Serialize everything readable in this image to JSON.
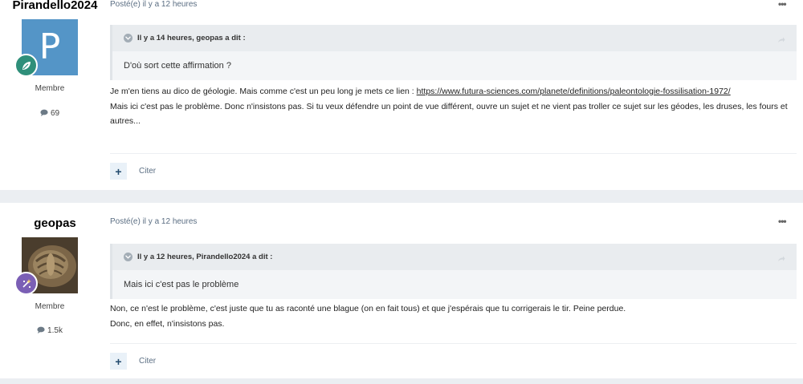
{
  "posts": [
    {
      "author": "Pirandello2024",
      "avatar_letter": "P",
      "avatar_color": "#5495c7",
      "badge_icon": "leaf-icon",
      "badge_color": "#2f8f7a",
      "role": "Membre",
      "post_count": "69",
      "posted": "Posté(e) il y a 12 heures",
      "quote": {
        "header": "Il y a 14 heures, geopas a dit :",
        "text": "D'où sort cette affirmation ?"
      },
      "content": {
        "line1_prefix": "Je m'en tiens au dico de géologie. Mais comme c'est un peu long je mets ce lien : ",
        "link": "https://www.futura-sciences.com/planete/definitions/paleontologie-fossilisation-1972/",
        "line2": "Mais ici c'est pas le problème. Donc n'insistons pas. Si tu veux défendre un point de vue différent, ouvre un sujet et ne vient pas troller ce sujet sur les géodes, les druses, les fours et autres..."
      },
      "action_plus": "+",
      "action_cite": "Citer"
    },
    {
      "author": "geopas",
      "badge_icon": "sparkle-icon",
      "badge_color": "#7b5fb5",
      "role": "Membre",
      "post_count": "1.5k",
      "posted": "Posté(e) il y a 12 heures",
      "quote": {
        "header": "Il y a 12 heures, Pirandello2024 a dit :",
        "text": "Mais ici c'est pas le problème"
      },
      "content": {
        "line1": "Non, ce n'est le problème, c'est juste que tu as raconté une blague (on en fait tous) et que j'espérais que tu corrigerais le tir. Peine perdue.",
        "line2": "Donc, en effet, n'insistons pas."
      },
      "action_plus": "+",
      "action_cite": "Citer"
    }
  ]
}
